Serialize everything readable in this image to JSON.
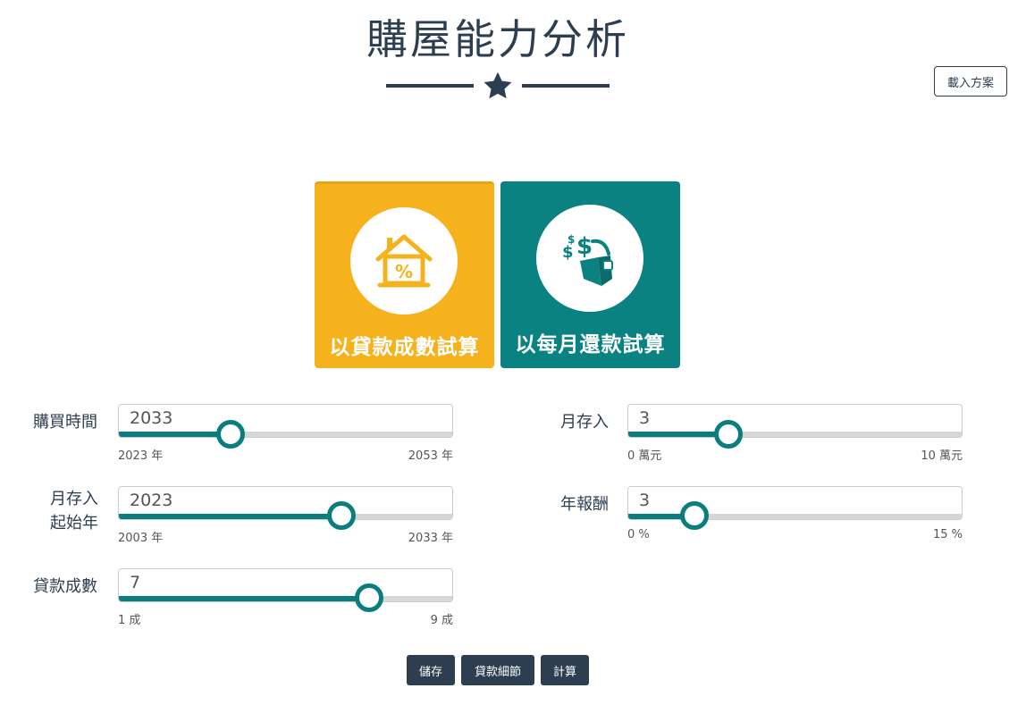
{
  "header": {
    "title": "購屋能力分析",
    "load_plan_label": "載入方案",
    "divider_icon": "star-icon"
  },
  "modes": [
    {
      "label": "以貸款成數試算",
      "icon": "house-percent-icon",
      "color": "#f5b21d"
    },
    {
      "label": "以每月還款試算",
      "icon": "money-wallet-icon",
      "color": "#0a8282"
    }
  ],
  "fields": {
    "purchase_time": {
      "label": "購買時間",
      "value": "2033",
      "min_label": "2023 年",
      "max_label": "2053 年",
      "fraction": 0.333
    },
    "monthly_deposit_start": {
      "label_line1": "月存入",
      "label_line2": "起始年",
      "value": "2023",
      "min_label": "2003 年",
      "max_label": "2033 年",
      "fraction": 0.667
    },
    "loan_ratio": {
      "label": "貸款成數",
      "value": "7",
      "min_label": "1 成",
      "max_label": "9 成",
      "fraction": 0.75
    },
    "monthly_deposit": {
      "label": "月存入",
      "value": "3",
      "min_label": "0 萬元",
      "max_label": "10 萬元",
      "fraction": 0.3
    },
    "annual_return": {
      "label": "年報酬",
      "value": "3",
      "min_label": "0 %",
      "max_label": "15 %",
      "fraction": 0.2
    }
  },
  "actions": {
    "save_label": "儲存",
    "loan_details_label": "貸款細節",
    "calculate_label": "計算"
  },
  "colors": {
    "primary": "#2c3e50",
    "accent_yellow": "#f5b21d",
    "accent_teal": "#0a8282"
  }
}
